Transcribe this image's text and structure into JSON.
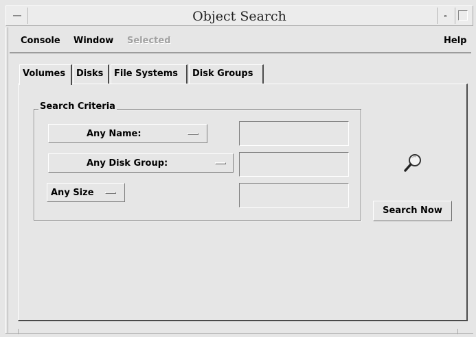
{
  "window": {
    "title": "Object Search"
  },
  "menubar": {
    "items": [
      {
        "label": "Console",
        "enabled": true
      },
      {
        "label": "Window",
        "enabled": true
      },
      {
        "label": "Selected",
        "enabled": false
      },
      {
        "label": "Help",
        "enabled": true
      }
    ]
  },
  "tabs": [
    {
      "label": "Volumes",
      "active": true
    },
    {
      "label": "Disks",
      "active": false
    },
    {
      "label": "File Systems",
      "active": false
    },
    {
      "label": "Disk Groups",
      "active": false
    }
  ],
  "criteria": {
    "group_label": "Search Criteria",
    "name_option": "Any Name:",
    "name_value": "",
    "diskgroup_option": "Any Disk Group:",
    "diskgroup_value": "",
    "size_option": "Any Size",
    "size_value": ""
  },
  "search_button": {
    "label": "Search Now",
    "icon": "magnifier-icon"
  },
  "colors": {
    "background": "#e6e6e6",
    "disabled_text": "#a0a0a0"
  }
}
